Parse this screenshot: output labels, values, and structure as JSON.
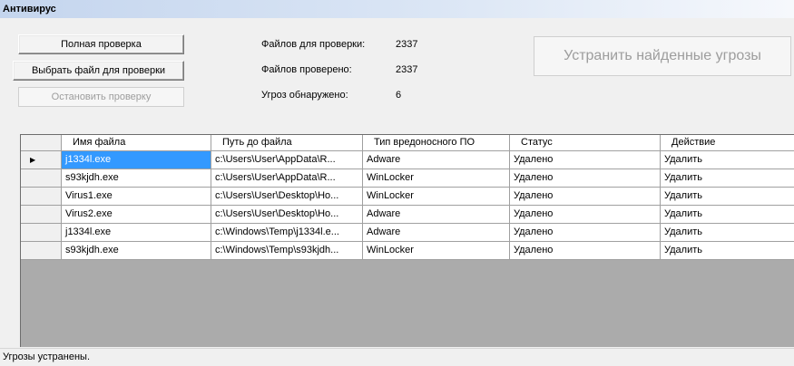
{
  "window": {
    "title": "Антивирус"
  },
  "buttons": {
    "full_scan": "Полная проверка",
    "choose_file": "Выбрать файл для проверки",
    "stop_scan": "Остановить проверку",
    "remove_threats": "Устранить найденные угрозы"
  },
  "stats": {
    "files_to_scan_label": "Файлов для проверки:",
    "files_to_scan_value": "2337",
    "files_scanned_label": "Файлов проверено:",
    "files_scanned_value": "2337",
    "threats_label": "Угроз обнаружено:",
    "threats_value": "6"
  },
  "table": {
    "columns": [
      "Имя файла",
      "Путь до файла",
      "Тип вредоносного ПО",
      "Статус",
      "Действие"
    ],
    "rows": [
      [
        "j1334l.exe",
        "c:\\Users\\User\\AppData\\R...",
        "Adware",
        "Удалено",
        "Удалить"
      ],
      [
        "s93kjdh.exe",
        "c:\\Users\\User\\AppData\\R...",
        "WinLocker",
        "Удалено",
        "Удалить"
      ],
      [
        "Virus1.exe",
        "c:\\Users\\User\\Desktop\\Ho...",
        "WinLocker",
        "Удалено",
        "Удалить"
      ],
      [
        "Virus2.exe",
        "c:\\Users\\User\\Desktop\\Ho...",
        "Adware",
        "Удалено",
        "Удалить"
      ],
      [
        "j1334l.exe",
        "c:\\Windows\\Temp\\j1334l.e...",
        "Adware",
        "Удалено",
        "Удалить"
      ],
      [
        "s93kjdh.exe",
        "c:\\Windows\\Temp\\s93kjdh...",
        "WinLocker",
        "Удалено",
        "Удалить"
      ]
    ],
    "selected_row_index": 0,
    "current_row_marker": "▶"
  },
  "status_bar": {
    "text": "Угрозы устранены."
  }
}
